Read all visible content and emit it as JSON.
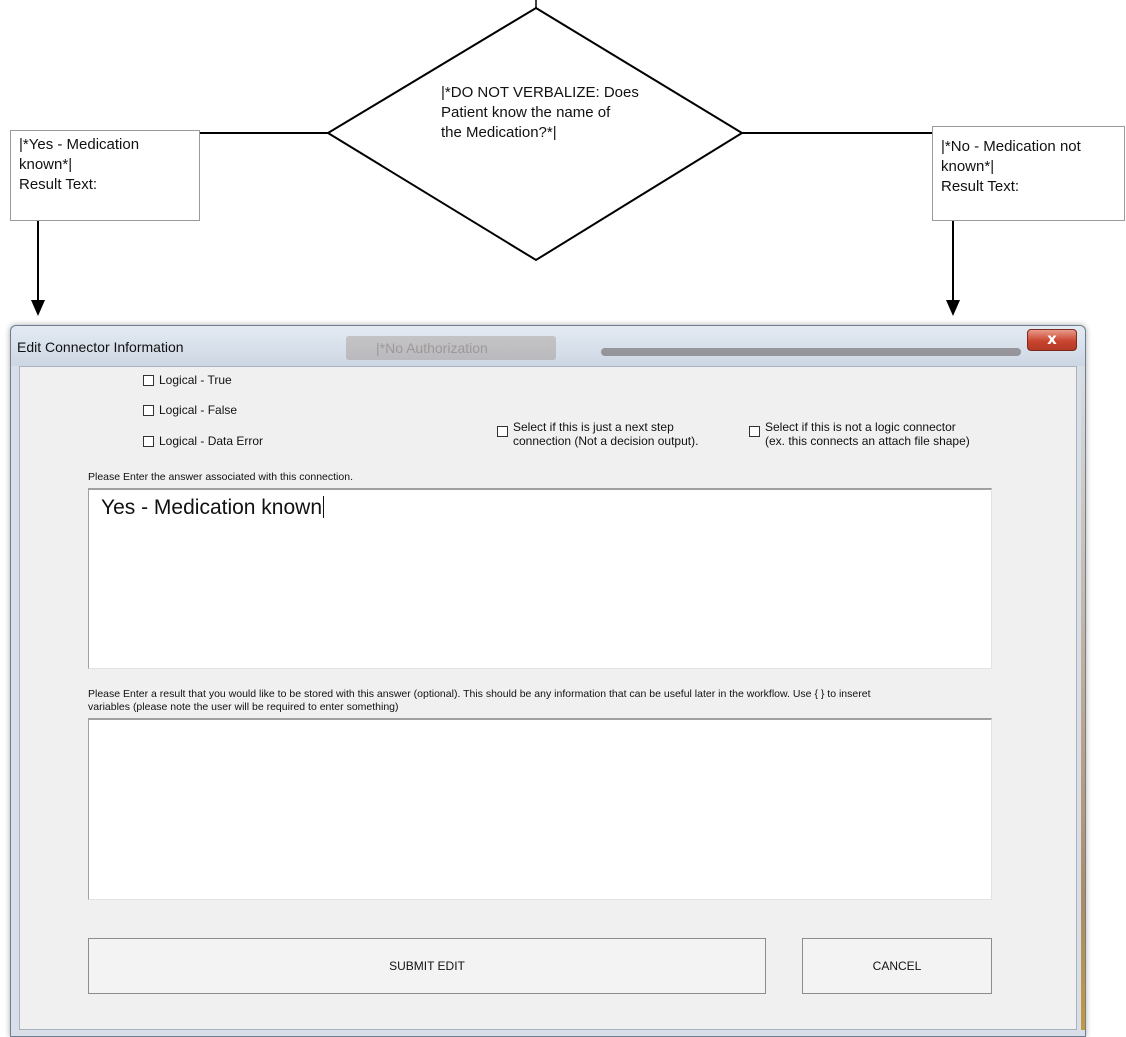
{
  "flowchart": {
    "decision_lines": [
      "|*DO NOT VERBALIZE: Does",
      "Patient know the name of",
      "the Medication?*|"
    ],
    "yes_box_lines": [
      "|*Yes - Medication",
      "known*|",
      "Result Text:"
    ],
    "no_box_lines": [
      "|*No - Medication  not",
      "known*|",
      "Result Text:"
    ]
  },
  "dialog": {
    "title": "Edit Connector Information",
    "background_window_title": "|*No Authorization",
    "close_label": "x",
    "checkboxes": {
      "logical_true": "Logical - True",
      "logical_false": "Logical - False",
      "logical_data_error": "Logical - Data Error",
      "next_step_lines": [
        "Select if this is just a next step",
        "connection (Not a decision output)."
      ],
      "not_logic_lines": [
        "Select if this is not a logic connector",
        "(ex. this connects an attach file shape)"
      ]
    },
    "answer_prompt": "Please Enter the answer associated with this connection.",
    "answer_value": "Yes - Medication known",
    "result_prompt_lines": [
      "Please Enter a result that you would like to be stored with this answer (optional). This should be any information that can be useful later in the workflow. Use { } to inseret",
      "variables (please note the user will be required to enter something)"
    ],
    "result_value": "",
    "submit_label": "SUBMIT EDIT",
    "cancel_label": "CANCEL"
  },
  "colors": {
    "close_button": "#c9452f",
    "dialog_frame": "#d8dfe8",
    "client_area": "#f0f0f0"
  }
}
